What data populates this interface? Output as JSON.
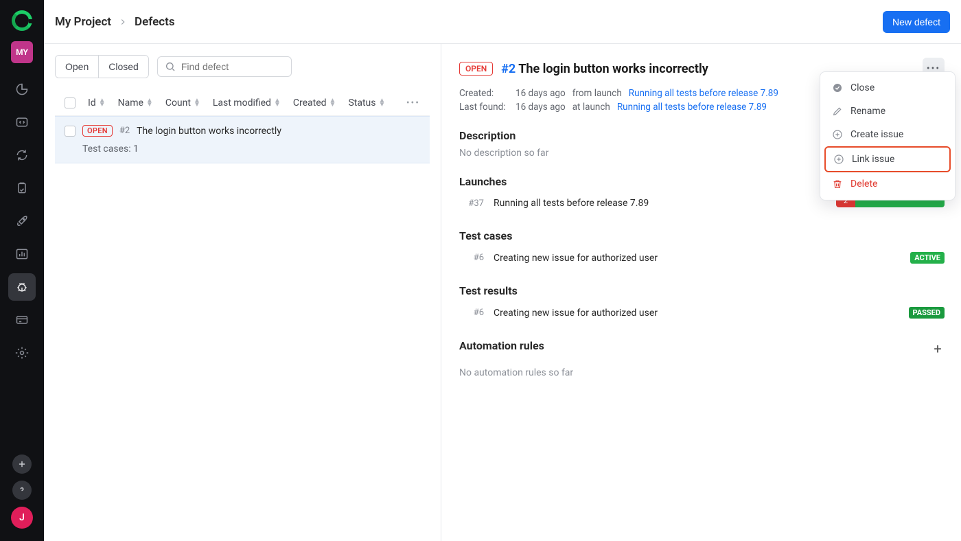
{
  "sidebar": {
    "project_badge": "MY",
    "user_initial": "J"
  },
  "breadcrumb": {
    "project": "My Project",
    "page": "Defects"
  },
  "actions": {
    "new_defect": "New defect"
  },
  "filters": {
    "open": "Open",
    "closed": "Closed",
    "search_placeholder": "Find defect"
  },
  "columns": {
    "id": "Id",
    "name": "Name",
    "count": "Count",
    "last_modified": "Last modified",
    "created": "Created",
    "status": "Status"
  },
  "defect_row": {
    "badge": "OPEN",
    "id": "#2",
    "title": "The login button works incorrectly",
    "subline": "Test cases: 1"
  },
  "detail": {
    "badge": "OPEN",
    "num": "#2",
    "title": "The login button works incorrectly",
    "created_label": "Created:",
    "created_time": "16 days ago",
    "created_from": "from launch",
    "created_link": "Running all tests before release 7.89",
    "lastfound_label": "Last found:",
    "lastfound_time": "16 days ago",
    "lastfound_at": "at launch",
    "lastfound_link": "Running all tests before release 7.89"
  },
  "sections": {
    "description": "Description",
    "description_empty": "No description so far",
    "launches": "Launches",
    "testcases": "Test cases",
    "testresults": "Test results",
    "automation": "Automation rules",
    "automation_empty": "No automation rules so far"
  },
  "launch": {
    "id": "#37",
    "name": "Running all tests before release 7.89",
    "fail_count": "2"
  },
  "testcase": {
    "id": "#6",
    "name": "Creating new issue for authorized user",
    "tag": "ACTIVE"
  },
  "testresult": {
    "id": "#6",
    "name": "Creating new issue for authorized user",
    "tag": "PASSED"
  },
  "menu": {
    "close": "Close",
    "rename": "Rename",
    "create_issue": "Create issue",
    "link_issue": "Link issue",
    "delete": "Delete"
  }
}
